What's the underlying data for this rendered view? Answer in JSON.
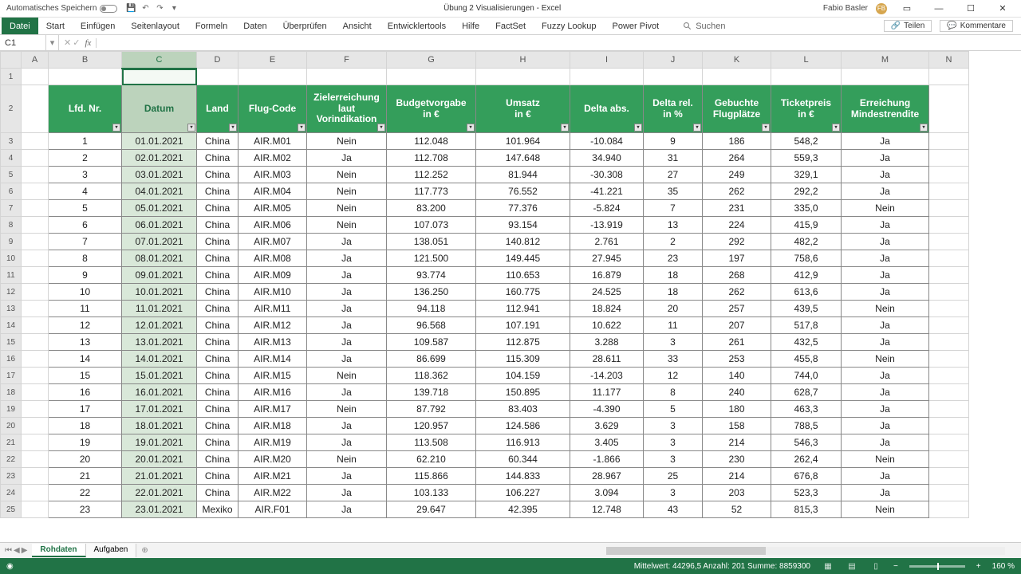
{
  "titlebar": {
    "autosave_label": "Automatisches Speichern",
    "title": "Übung 2 Visualisierungen  -  Excel",
    "user": "Fabio Basler",
    "avatar_initials": "FB"
  },
  "ribbon": {
    "tabs": [
      "Datei",
      "Start",
      "Einfügen",
      "Seitenlayout",
      "Formeln",
      "Daten",
      "Überprüfen",
      "Ansicht",
      "Entwicklertools",
      "Hilfe",
      "FactSet",
      "Fuzzy Lookup",
      "Power Pivot"
    ],
    "search_placeholder": "Suchen",
    "share": "Teilen",
    "comments": "Kommentare"
  },
  "formula": {
    "name_box": "C1",
    "value": ""
  },
  "cols": [
    "A",
    "B",
    "C",
    "D",
    "E",
    "F",
    "G",
    "H",
    "I",
    "J",
    "K",
    "L",
    "M",
    "N"
  ],
  "selected_col": "C",
  "headers": [
    "Lfd. Nr.",
    "Datum",
    "Land",
    "Flug-Code",
    "Zielerreichung laut Vorindikation",
    "Budgetvorgabe in €",
    "Umsatz in €",
    "Delta abs.",
    "Delta rel. in %",
    "Gebuchte Flugplätze",
    "Ticketpreis in €",
    "Erreichung Mindestrendite"
  ],
  "rows": [
    [
      1,
      "01.01.2021",
      "China",
      "AIR.M01",
      "Nein",
      "112.048",
      "101.964",
      "-10.084",
      "9",
      "186",
      "548,2",
      "Ja"
    ],
    [
      2,
      "02.01.2021",
      "China",
      "AIR.M02",
      "Ja",
      "112.708",
      "147.648",
      "34.940",
      "31",
      "264",
      "559,3",
      "Ja"
    ],
    [
      3,
      "03.01.2021",
      "China",
      "AIR.M03",
      "Nein",
      "112.252",
      "81.944",
      "-30.308",
      "27",
      "249",
      "329,1",
      "Ja"
    ],
    [
      4,
      "04.01.2021",
      "China",
      "AIR.M04",
      "Nein",
      "117.773",
      "76.552",
      "-41.221",
      "35",
      "262",
      "292,2",
      "Ja"
    ],
    [
      5,
      "05.01.2021",
      "China",
      "AIR.M05",
      "Nein",
      "83.200",
      "77.376",
      "-5.824",
      "7",
      "231",
      "335,0",
      "Nein"
    ],
    [
      6,
      "06.01.2021",
      "China",
      "AIR.M06",
      "Nein",
      "107.073",
      "93.154",
      "-13.919",
      "13",
      "224",
      "415,9",
      "Ja"
    ],
    [
      7,
      "07.01.2021",
      "China",
      "AIR.M07",
      "Ja",
      "138.051",
      "140.812",
      "2.761",
      "2",
      "292",
      "482,2",
      "Ja"
    ],
    [
      8,
      "08.01.2021",
      "China",
      "AIR.M08",
      "Ja",
      "121.500",
      "149.445",
      "27.945",
      "23",
      "197",
      "758,6",
      "Ja"
    ],
    [
      9,
      "09.01.2021",
      "China",
      "AIR.M09",
      "Ja",
      "93.774",
      "110.653",
      "16.879",
      "18",
      "268",
      "412,9",
      "Ja"
    ],
    [
      10,
      "10.01.2021",
      "China",
      "AIR.M10",
      "Ja",
      "136.250",
      "160.775",
      "24.525",
      "18",
      "262",
      "613,6",
      "Ja"
    ],
    [
      11,
      "11.01.2021",
      "China",
      "AIR.M11",
      "Ja",
      "94.118",
      "112.941",
      "18.824",
      "20",
      "257",
      "439,5",
      "Nein"
    ],
    [
      12,
      "12.01.2021",
      "China",
      "AIR.M12",
      "Ja",
      "96.568",
      "107.191",
      "10.622",
      "11",
      "207",
      "517,8",
      "Ja"
    ],
    [
      13,
      "13.01.2021",
      "China",
      "AIR.M13",
      "Ja",
      "109.587",
      "112.875",
      "3.288",
      "3",
      "261",
      "432,5",
      "Ja"
    ],
    [
      14,
      "14.01.2021",
      "China",
      "AIR.M14",
      "Ja",
      "86.699",
      "115.309",
      "28.611",
      "33",
      "253",
      "455,8",
      "Nein"
    ],
    [
      15,
      "15.01.2021",
      "China",
      "AIR.M15",
      "Nein",
      "118.362",
      "104.159",
      "-14.203",
      "12",
      "140",
      "744,0",
      "Ja"
    ],
    [
      16,
      "16.01.2021",
      "China",
      "AIR.M16",
      "Ja",
      "139.718",
      "150.895",
      "11.177",
      "8",
      "240",
      "628,7",
      "Ja"
    ],
    [
      17,
      "17.01.2021",
      "China",
      "AIR.M17",
      "Nein",
      "87.792",
      "83.403",
      "-4.390",
      "5",
      "180",
      "463,3",
      "Ja"
    ],
    [
      18,
      "18.01.2021",
      "China",
      "AIR.M18",
      "Ja",
      "120.957",
      "124.586",
      "3.629",
      "3",
      "158",
      "788,5",
      "Ja"
    ],
    [
      19,
      "19.01.2021",
      "China",
      "AIR.M19",
      "Ja",
      "113.508",
      "116.913",
      "3.405",
      "3",
      "214",
      "546,3",
      "Ja"
    ],
    [
      20,
      "20.01.2021",
      "China",
      "AIR.M20",
      "Nein",
      "62.210",
      "60.344",
      "-1.866",
      "3",
      "230",
      "262,4",
      "Nein"
    ],
    [
      21,
      "21.01.2021",
      "China",
      "AIR.M21",
      "Ja",
      "115.866",
      "144.833",
      "28.967",
      "25",
      "214",
      "676,8",
      "Ja"
    ],
    [
      22,
      "22.01.2021",
      "China",
      "AIR.M22",
      "Ja",
      "103.133",
      "106.227",
      "3.094",
      "3",
      "203",
      "523,3",
      "Ja"
    ],
    [
      23,
      "23.01.2021",
      "Mexiko",
      "AIR.F01",
      "Ja",
      "29.647",
      "42.395",
      "12.748",
      "43",
      "52",
      "815,3",
      "Nein"
    ]
  ],
  "sheets": {
    "tabs": [
      "Rohdaten",
      "Aufgaben"
    ],
    "active": 0
  },
  "status": {
    "aggregates": "Mittelwert: 44296,5    Anzahl: 201    Summe: 8859300",
    "zoom": "160 %"
  }
}
